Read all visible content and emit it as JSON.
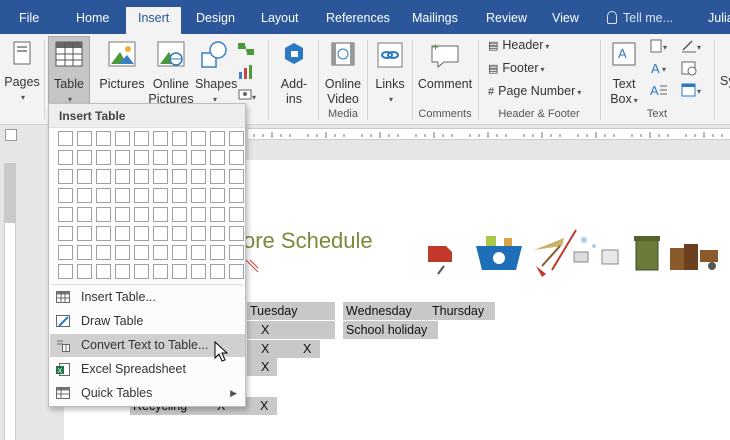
{
  "tabs": [
    "File",
    "Home",
    "Insert",
    "Design",
    "Layout",
    "References",
    "Mailings",
    "Review",
    "View"
  ],
  "tell_me": "Tell me...",
  "user_name": "Julia",
  "ribbon": {
    "pages": "Pages",
    "table": "Table",
    "pictures": "Pictures",
    "online_pictures_1": "Online",
    "online_pictures_2": "Pictures",
    "shapes": "Shapes",
    "addins_1": "Add-",
    "addins_2": "ins",
    "online_video_1": "Online",
    "online_video_2": "Video",
    "links": "Links",
    "comment": "Comment",
    "header": "Header",
    "footer": "Footer",
    "page_number": "Page Number",
    "text_box_1": "Text",
    "text_box_2": "Box",
    "sym": "Sy",
    "groups": {
      "media": "Media",
      "comments": "Comments",
      "header_footer": "Header & Footer",
      "text": "Text"
    }
  },
  "insert_table": {
    "title": "Insert Table",
    "grid_cols": 10,
    "grid_rows": 8,
    "menu": [
      {
        "label": "Insert Table...",
        "icon": "insert-table-icon"
      },
      {
        "label": "Draw Table",
        "icon": "draw-table-icon"
      },
      {
        "label": "Convert Text to Table...",
        "icon": "convert-text-to-table-icon",
        "highlighted": true
      },
      {
        "label": "Excel Spreadsheet",
        "icon": "excel-icon"
      },
      {
        "label": "Quick Tables",
        "icon": "quick-tables-icon",
        "submenu": true
      }
    ]
  },
  "document": {
    "title_fragment": "ore Schedule",
    "row_label_fragment": "Recycling",
    "headers": [
      "Tuesday",
      "Wednesday",
      "Thursday"
    ],
    "marks": {
      "r1_tue": "X",
      "r1_wed": "School holiday",
      "r2_tue": "X",
      "r2_x2": "X",
      "r3_tue": "X",
      "r5_mon": "X",
      "r5_tue": "X"
    }
  },
  "colors": {
    "accent": "#2b579a",
    "title_green": "#7a8a3a"
  }
}
